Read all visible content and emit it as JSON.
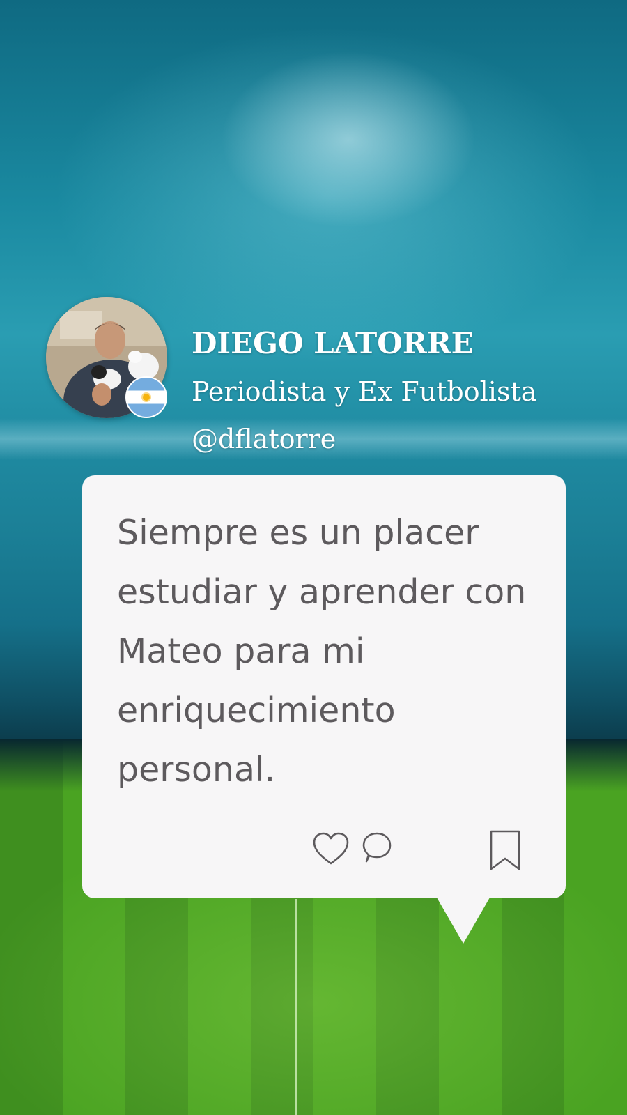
{
  "profile": {
    "name": "DIEGO LATORRE",
    "role": "Periodista y Ex Futbolista",
    "handle": "@dflatorre"
  },
  "post": {
    "text": "Siempre es un placer estudiar y aprender con Mateo para mi enriquecimiento personal."
  },
  "icons": {
    "like": "heart-icon",
    "comment": "comment-icon",
    "save": "bookmark-icon",
    "badge": "argentina-flag-icon"
  },
  "colors": {
    "card_background": "#f7f6f7",
    "quote_text": "#5d5a5d",
    "icon_stroke": "#5d5a5d",
    "header_text": "#ffffff"
  }
}
